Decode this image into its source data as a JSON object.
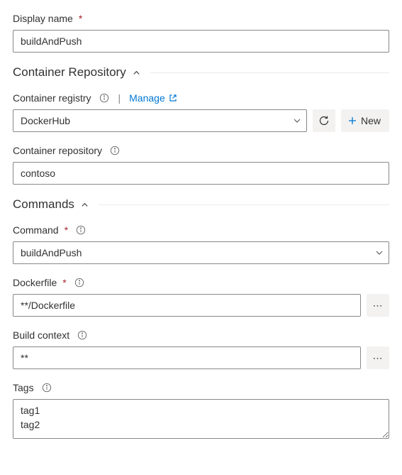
{
  "displayName": {
    "label": "Display name",
    "value": "buildAndPush"
  },
  "sections": {
    "containerRepository": {
      "title": "Container Repository"
    },
    "commands": {
      "title": "Commands"
    }
  },
  "containerRegistry": {
    "label": "Container registry",
    "manageLabel": "Manage",
    "selected": "DockerHub",
    "newLabel": "New"
  },
  "containerRepo": {
    "label": "Container repository",
    "value": "contoso"
  },
  "command": {
    "label": "Command",
    "selected": "buildAndPush"
  },
  "dockerfile": {
    "label": "Dockerfile",
    "value": "**/Dockerfile"
  },
  "buildContext": {
    "label": "Build context",
    "value": "**"
  },
  "tags": {
    "label": "Tags",
    "value": "tag1\ntag2"
  },
  "ellipsis": "⋯"
}
